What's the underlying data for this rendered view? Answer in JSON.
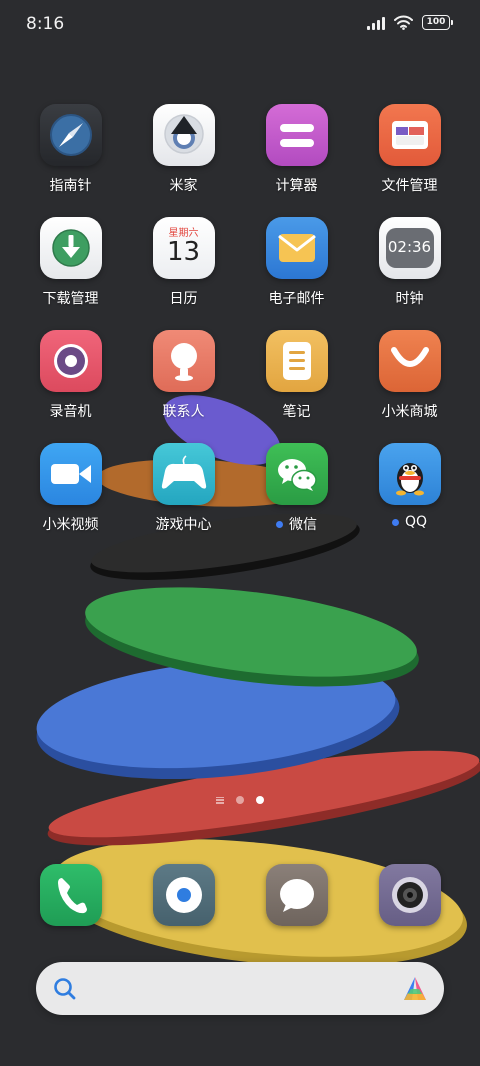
{
  "status_bar": {
    "time": "8:16",
    "battery": "100"
  },
  "apps": [
    {
      "label": "指南针",
      "icon": "compass-icon",
      "badge": false
    },
    {
      "label": "米家",
      "icon": "mijia-icon",
      "badge": false
    },
    {
      "label": "计算器",
      "icon": "calculator-icon",
      "badge": false
    },
    {
      "label": "文件管理",
      "icon": "file-manager-icon",
      "badge": false
    },
    {
      "label": "下载管理",
      "icon": "download-icon",
      "badge": false
    },
    {
      "label": "日历",
      "icon": "calendar-icon",
      "badge": false,
      "calendar_weekday": "星期六",
      "calendar_day": "13"
    },
    {
      "label": "电子邮件",
      "icon": "mail-icon",
      "badge": false
    },
    {
      "label": "时钟",
      "icon": "clock-icon",
      "badge": false,
      "clock_time": "02:36"
    },
    {
      "label": "录音机",
      "icon": "recorder-icon",
      "badge": false
    },
    {
      "label": "联系人",
      "icon": "contacts-icon",
      "badge": false
    },
    {
      "label": "笔记",
      "icon": "notes-icon",
      "badge": false
    },
    {
      "label": "小米商城",
      "icon": "mi-store-icon",
      "badge": false
    },
    {
      "label": "小米视频",
      "icon": "video-icon",
      "badge": false
    },
    {
      "label": "游戏中心",
      "icon": "game-center-icon",
      "badge": false
    },
    {
      "label": "微信",
      "icon": "wechat-icon",
      "badge": true
    },
    {
      "label": "QQ",
      "icon": "qq-icon",
      "badge": true
    }
  ],
  "dock": [
    {
      "icon": "phone-icon"
    },
    {
      "icon": "messaging-icon"
    },
    {
      "icon": "chat-bubble-icon"
    },
    {
      "icon": "camera-icon"
    }
  ],
  "page_indicator": {
    "pages": 2,
    "active": 2
  },
  "search": {
    "value": "",
    "placeholder": ""
  },
  "colors": {
    "background": "#2b2c2f",
    "badge_dot": "#3f7cf2"
  }
}
